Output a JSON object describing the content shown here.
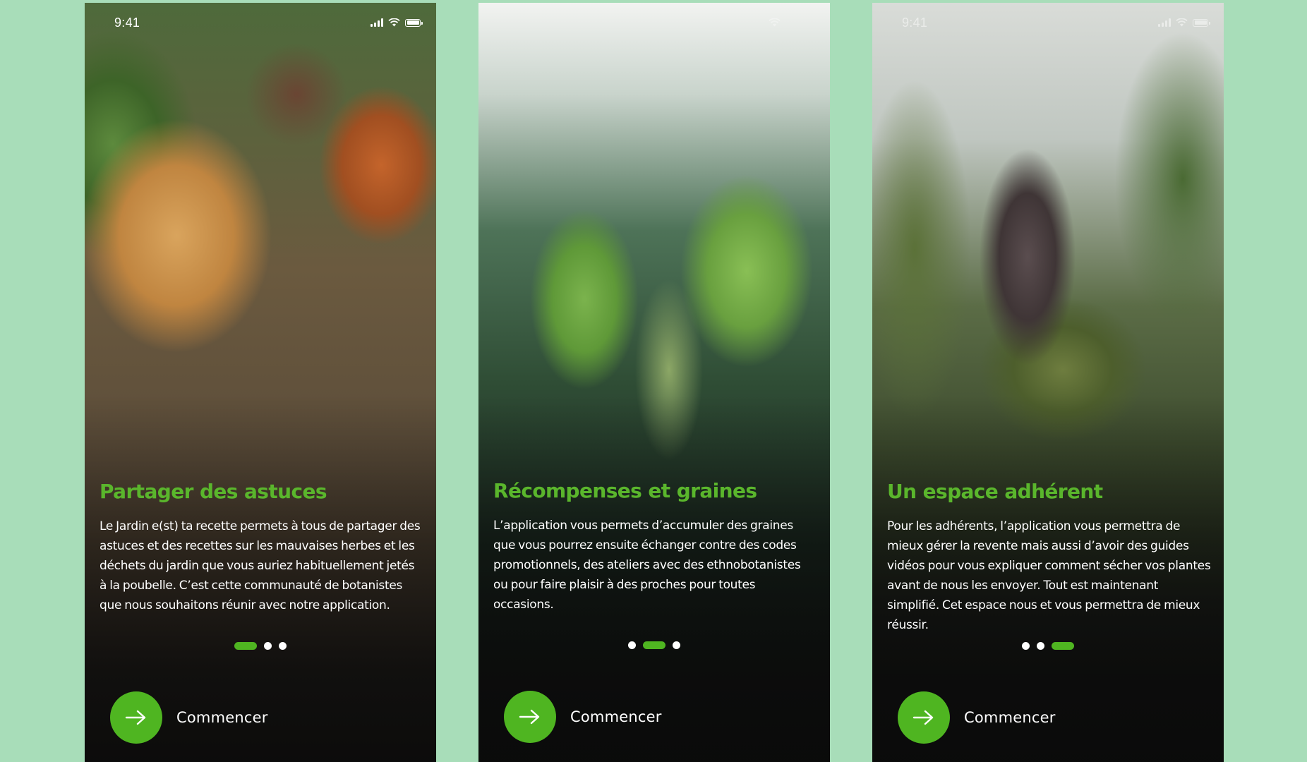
{
  "colors": {
    "page_background": "#a8ddb9",
    "accent_green": "#4fb521",
    "title_green": "#5ab62c",
    "text": "#ffffff"
  },
  "screens": [
    {
      "status_time": "9:41",
      "title": "Partager des astuces",
      "body": "Le Jardin e(st) ta recette permets à tous de partager des astuces et des recettes sur les mauvaises herbes et les déchets du jardin que vous auriez habituellement jetés à la poubelle. C’est cette communauté de botanistes que nous souhaitons réunir avec notre application.",
      "page_index": 1,
      "page_count": 3,
      "cta_label": "Commencer",
      "cta_icon": "arrow-right-icon"
    },
    {
      "status_time": "",
      "title": "Récompenses et graines",
      "body": "L’application vous permets d’accumuler des graines que vous pourrez ensuite échanger contre des codes promotionnels, des ateliers avec des ethnobotanistes ou pour faire plaisir à des proches pour toutes occasions.",
      "page_index": 2,
      "page_count": 3,
      "cta_label": "Commencer",
      "cta_icon": "arrow-right-icon"
    },
    {
      "status_time": "9:41",
      "title": "Un espace adhérent",
      "body": "Pour les adhérents, l’application vous permettra de mieux gérer la revente mais aussi d’avoir des guides vidéos pour vous expliquer comment sécher vos  plantes avant de nous les envoyer. Tout est maintenant simplifié. Cet espace nous et vous permettra de mieux réussir.",
      "page_index": 3,
      "page_count": 3,
      "cta_label": "Commencer",
      "cta_icon": "arrow-right-icon"
    }
  ]
}
